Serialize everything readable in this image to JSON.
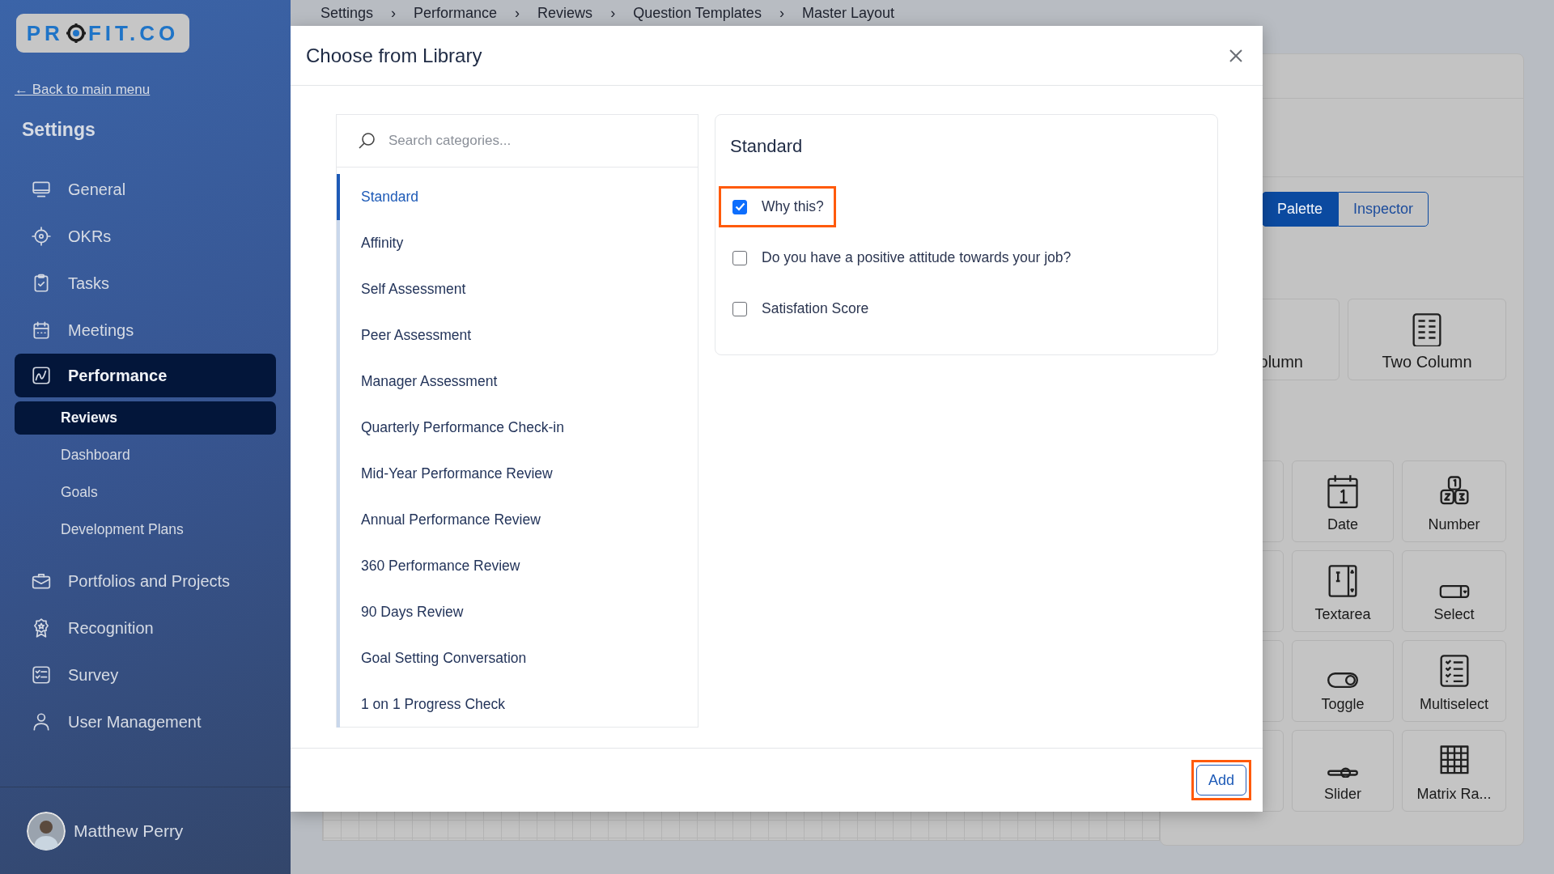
{
  "logo": {
    "parts": [
      "PR",
      "FIT.CO"
    ]
  },
  "back_link": "← Back to main menu",
  "sidebar": {
    "title": "Settings",
    "items": [
      {
        "label": "General",
        "selected": false
      },
      {
        "label": "OKRs",
        "selected": false
      },
      {
        "label": "Tasks",
        "selected": false
      },
      {
        "label": "Meetings",
        "selected": false
      },
      {
        "label": "Performance",
        "selected": true,
        "children": [
          {
            "label": "Reviews",
            "selected": true
          },
          {
            "label": "Dashboard",
            "selected": false
          },
          {
            "label": "Goals",
            "selected": false
          },
          {
            "label": "Development Plans",
            "selected": false
          }
        ]
      },
      {
        "label": "Portfolios and Projects",
        "selected": false
      },
      {
        "label": "Recognition",
        "selected": false
      },
      {
        "label": "Survey",
        "selected": false
      },
      {
        "label": "User Management",
        "selected": false
      }
    ]
  },
  "user": {
    "name": "Matthew Perry"
  },
  "breadcrumb": {
    "separator": "›",
    "items": [
      "Settings",
      "Performance",
      "Reviews",
      "Question Templates",
      "Master Layout"
    ]
  },
  "panel": {
    "tabs": [
      {
        "label": "Palette",
        "selected": true
      },
      {
        "label": "Inspector",
        "selected": false
      }
    ],
    "layouts": [
      "olumn",
      "Two Column"
    ],
    "fields": [
      "Date",
      "Number",
      "Textarea",
      "Select",
      "Toggle",
      "Multiselect",
      "Slider",
      "Matrix Ra..."
    ]
  },
  "modal": {
    "title": "Choose from Library",
    "search": {
      "placeholder": "Search categories..."
    },
    "categories": [
      {
        "label": "Standard",
        "selected": true
      },
      {
        "label": "Affinity",
        "selected": false
      },
      {
        "label": "Self Assessment",
        "selected": false
      },
      {
        "label": "Peer Assessment",
        "selected": false
      },
      {
        "label": "Manager Assessment",
        "selected": false
      },
      {
        "label": "Quarterly Performance Check-in",
        "selected": false
      },
      {
        "label": "Mid-Year Performance Review",
        "selected": false
      },
      {
        "label": "Annual Performance Review",
        "selected": false
      },
      {
        "label": "360 Performance Review",
        "selected": false
      },
      {
        "label": "90 Days Review",
        "selected": false
      },
      {
        "label": "Goal Setting Conversation",
        "selected": false
      },
      {
        "label": "1 on 1 Progress Check",
        "selected": false
      }
    ],
    "section": {
      "title": "Standard",
      "questions": [
        {
          "label": "Why this?",
          "checked": true,
          "highlighted": true
        },
        {
          "label": "Do you have a positive attitude towards your job?",
          "checked": false,
          "highlighted": false
        },
        {
          "label": "Satisfation Score",
          "checked": false,
          "highlighted": false
        }
      ]
    },
    "add_button": {
      "label": "Add",
      "highlighted": true
    }
  }
}
